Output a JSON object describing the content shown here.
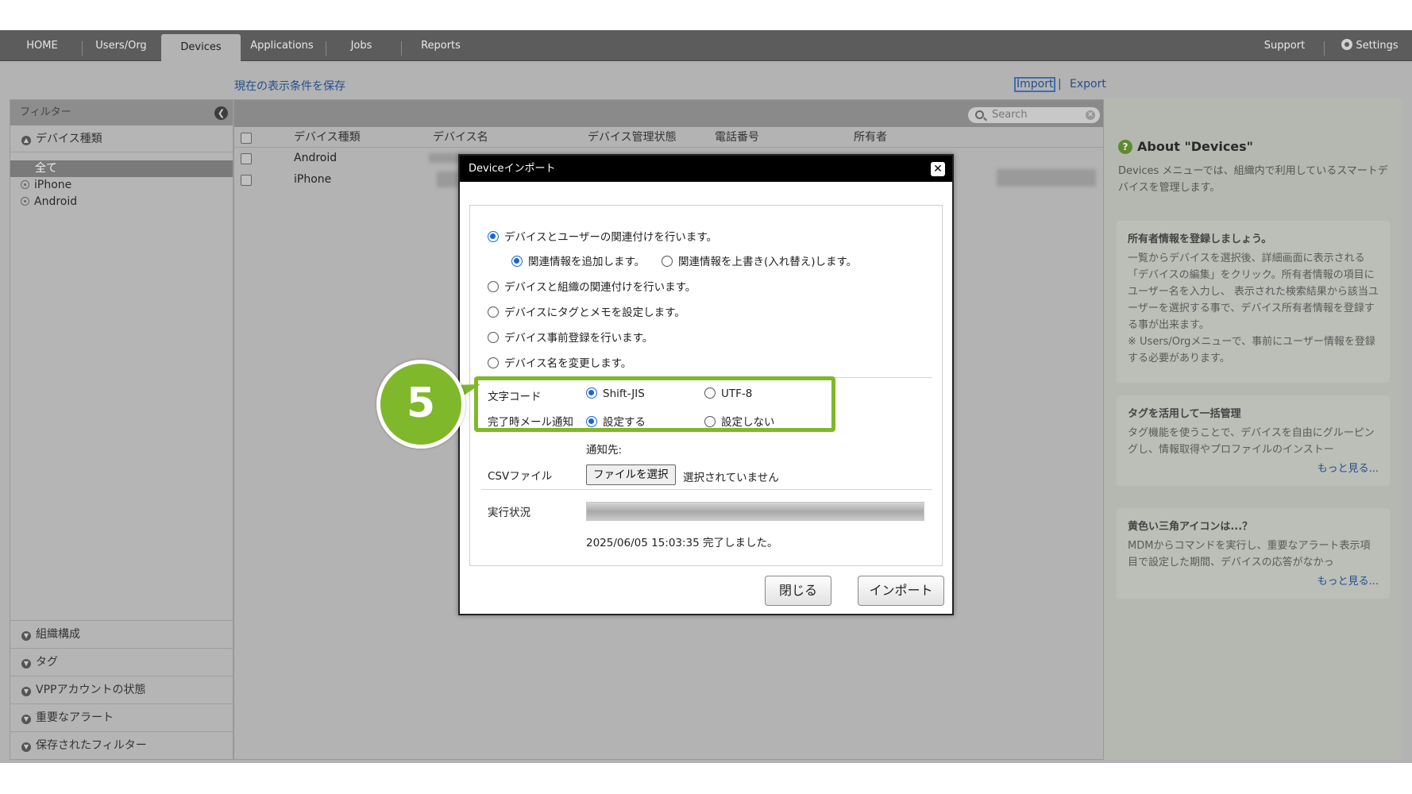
{
  "nav": {
    "tabs": [
      "HOME",
      "Users/Org",
      "Devices",
      "Applications",
      "Jobs",
      "Reports"
    ],
    "support": "Support",
    "settings": "Settings"
  },
  "links": {
    "save_view": "現在の表示条件を保存",
    "import": "Import",
    "pipe": "|",
    "export": "Export"
  },
  "sidebar": {
    "filter_title": "フィルター",
    "device_type_header": "デバイス種類",
    "items": [
      "全て",
      "iPhone",
      "Android"
    ],
    "sections": [
      "組織構成",
      "タグ",
      "VPPアカウントの状態",
      "重要なアラート",
      "保存されたフィルター"
    ]
  },
  "search": {
    "placeholder": "Search"
  },
  "table": {
    "columns": [
      "デバイス種類",
      "デバイス名",
      "デバイス管理状態",
      "電話番号",
      "所有者"
    ],
    "rows": [
      {
        "device_type": "Android"
      },
      {
        "device_type": "iPhone"
      }
    ]
  },
  "help": {
    "title": "About \"Devices\"",
    "description": "Devices メニューでは、組織内で利用しているスマートデバイスを管理します。",
    "cards": [
      {
        "heading": "所有者情報を登録しましょう。",
        "body": "一覧からデバイスを選択後、詳細画面に表示される「デバイスの編集」をクリック。所有者情報の項目にユーザー名を入力し、 表示された検索結果から該当ユーザーを選択する事で、デバイス所有者情報を登録する事が出来ます。",
        "note": "※ Users/Orgメニューで、事前にユーザー情報を登録する必要があります。",
        "more": ""
      },
      {
        "heading": "タグを活用して一括管理",
        "body": "タグ機能を使うことで、デバイスを自由にグルーピングし、情報取得やプロファイルのインストー",
        "note": "",
        "more": "もっと見る..."
      },
      {
        "heading": "黄色い三角アイコンは...？",
        "body": "MDMからコマンドを実行し、重要なアラート表示項目で設定した期間、デバイスの応答がなかっ",
        "note": "",
        "more": "もっと見る..."
      }
    ]
  },
  "modal": {
    "title": "Deviceインポート",
    "options": {
      "user_link": "デバイスとユーザーの関連付けを行います。",
      "add_link": "関連情報を追加します。",
      "overwrite_link": "関連情報を上書き(入れ替え)します。",
      "org_link": "デバイスと組織の関連付けを行います。",
      "tag_memo": "デバイスにタグとメモを設定します。",
      "pre_register": "デバイス事前登録を行います。",
      "rename": "デバイス名を変更します。"
    },
    "charset_label": "文字コード",
    "charset_options": [
      "Shift-JIS",
      "UTF-8"
    ],
    "mail_label": "完了時メール通知",
    "mail_options": [
      "設定する",
      "設定しない"
    ],
    "notify_to": "通知先:",
    "csv_label": "CSVファイル",
    "file_button": "ファイルを選択",
    "file_status": "選択されていません",
    "status_label": "実行状況",
    "status_text": "2025/06/05 15:03:35 完了しました。",
    "progress": 1.0,
    "close_button": "閉じる",
    "import_button": "インポート"
  },
  "callout": {
    "step": "5",
    "color": "#7fb82a"
  }
}
